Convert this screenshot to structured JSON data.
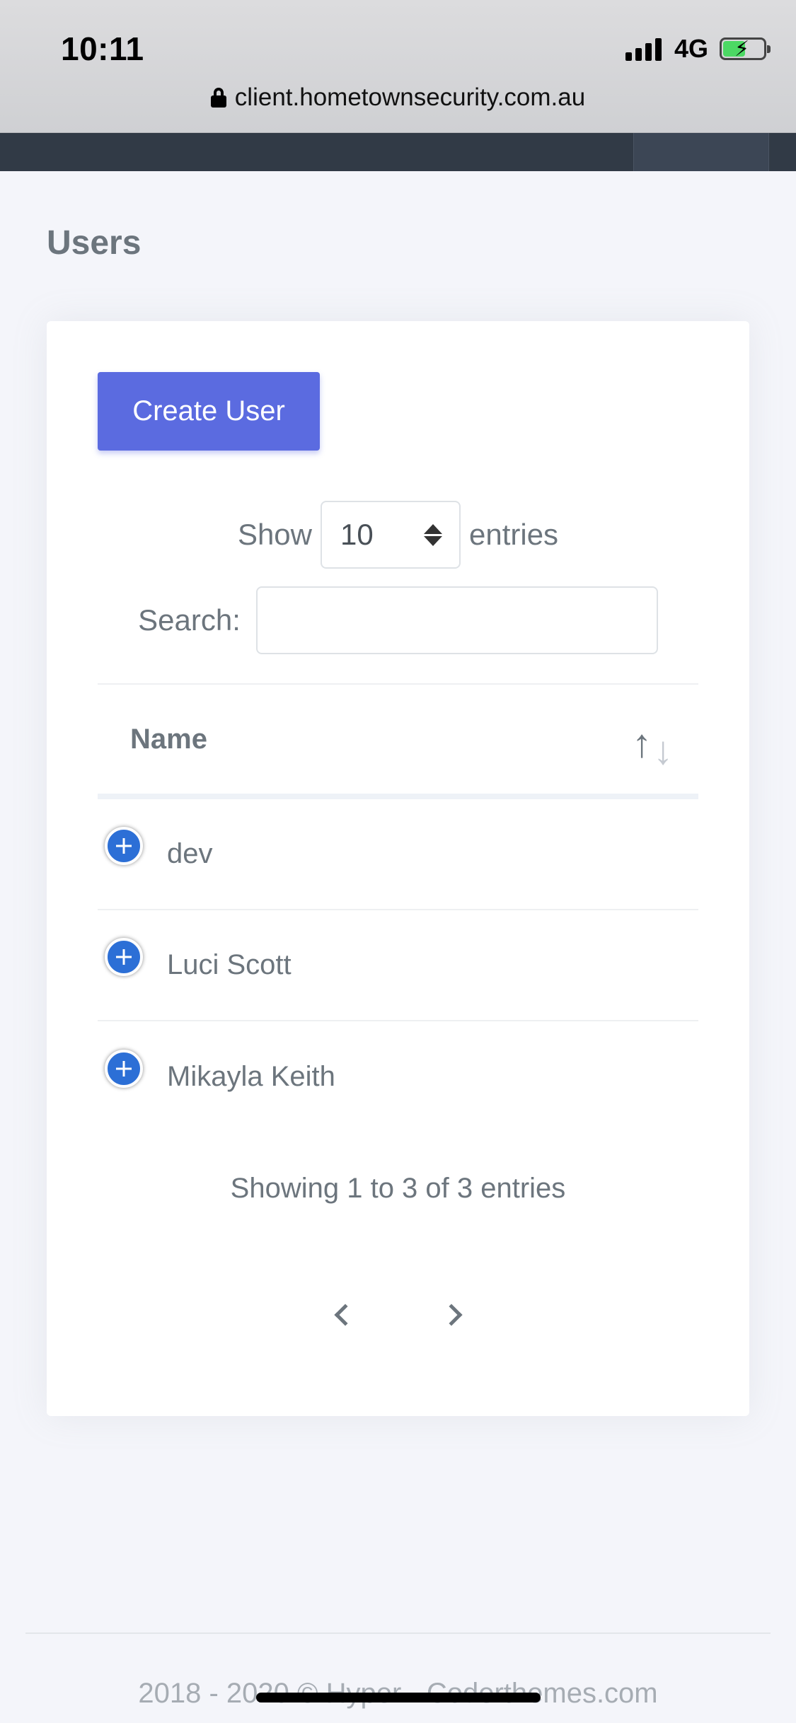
{
  "status_bar": {
    "time": "10:11",
    "network": "4G",
    "battery_level": 0.55,
    "battery_color": "#4cd964",
    "icons": [
      "signal-icon",
      "battery-charging-icon"
    ]
  },
  "browser": {
    "url": "client.hometownsecurity.com.au",
    "icon": "lock-icon"
  },
  "page": {
    "title": "Users"
  },
  "toolbar": {
    "create_label": "Create User",
    "accent_color": "#5b6be0"
  },
  "length_control": {
    "show_label": "Show",
    "selected": "10",
    "entries_label": "entries"
  },
  "search": {
    "label": "Search:",
    "value": "",
    "placeholder": ""
  },
  "table": {
    "columns": [
      {
        "label": "Name",
        "sort_icon": "sort-icon"
      }
    ],
    "rows": [
      {
        "name": "dev",
        "icon": "expand-plus-icon"
      },
      {
        "name": "Luci Scott",
        "icon": "expand-plus-icon"
      },
      {
        "name": "Mikayla Keith",
        "icon": "expand-plus-icon"
      }
    ],
    "info": "Showing 1 to 3 of 3 entries"
  },
  "pagination": {
    "prev_icon": "chevron-left-icon",
    "next_icon": "chevron-right-icon"
  },
  "footer": {
    "text": "2018 - 2020 © Hyper - Coderthemes.com"
  }
}
